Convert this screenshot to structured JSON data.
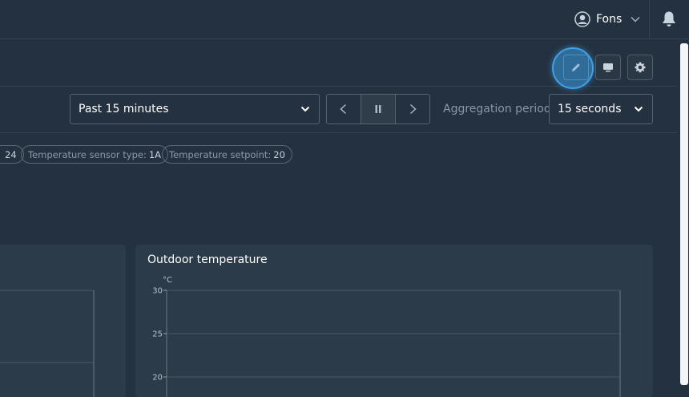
{
  "header": {
    "user_name": "Fons"
  },
  "filters": {
    "time_range": "Past 15 minutes",
    "aggregation_label": "Aggregation period:",
    "aggregation_value": "15 seconds"
  },
  "chips": [
    {
      "label": "",
      "value": "24"
    },
    {
      "label": "Temperature sensor type:",
      "value": "1A"
    },
    {
      "label": "Temperature setpoint:",
      "value": "20"
    }
  ],
  "cards": {
    "outdoor_title": "Outdoor temperature"
  },
  "chart_data": {
    "type": "line",
    "title": "Outdoor temperature",
    "ylabel": "°C",
    "yticks": [
      "30",
      "25",
      "20"
    ],
    "series": [],
    "grid": true
  },
  "colors": {
    "accent": "#3ea2e6",
    "background": "#243140",
    "card": "#2c3b49"
  },
  "icons": {
    "avatar": "user-circle-icon",
    "bell": "bell-icon",
    "edit": "pencil-icon",
    "display": "monitor-icon",
    "settings": "gear-icon"
  }
}
